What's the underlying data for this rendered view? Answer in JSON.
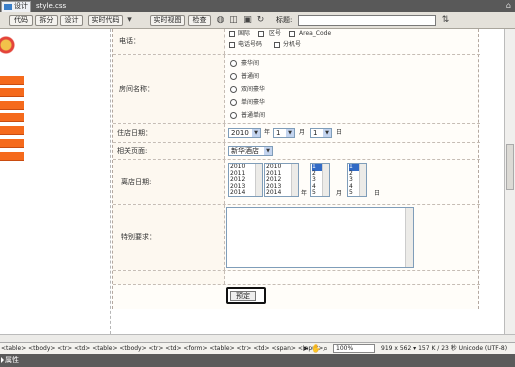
{
  "window": {
    "doc_tab": "设计",
    "file_name": "style.css",
    "right_glyph": "⌂"
  },
  "toolbar": {
    "code_label": "代码",
    "split_label": "拆分",
    "design_label": "设计",
    "live_code_label": "实时代码",
    "live_view_label": "实时视图",
    "inspect_label": "检查",
    "title_label": "标题:",
    "title_value": ""
  },
  "form": {
    "phone": {
      "label": "电话：",
      "line1": [
        "国际",
        "区号",
        "Area_Code"
      ],
      "line2": [
        "电话号码",
        "分机号"
      ]
    },
    "room": {
      "label": "房间名称：",
      "options": [
        "豪华间",
        "普通间",
        "双间豪华",
        "单间豪华",
        "普通单间"
      ]
    },
    "checkin": {
      "label": "住店日期：",
      "year": "2010",
      "year_unit": "年",
      "month": "1",
      "month_unit": "月",
      "day": "1",
      "day_unit": "日"
    },
    "related": {
      "label": "相关页面:",
      "value": "新华酒店"
    },
    "checkout": {
      "label": "离店日期:",
      "year_list_a": [
        "2010",
        "2011",
        "2012",
        "2013",
        "2014"
      ],
      "year_list_b": [
        "2010",
        "2011",
        "2012",
        "2013",
        "2014"
      ],
      "year_unit": "年",
      "month_list": [
        "1",
        "2",
        "3",
        "4",
        "5"
      ],
      "month_unit": "月",
      "day_list": [
        "1",
        "2",
        "3",
        "4",
        "5"
      ],
      "day_unit": "日"
    },
    "special": {
      "label": "特别要求："
    },
    "submit_label": "预定"
  },
  "status": {
    "tag_path": "<table> <tbody> <tr> <td> <table> <tbody> <tr> <td> <form> <table> <tr> <td> <span> <input>",
    "zoom": "100%",
    "info": "919 x 562 ▾ 157 K / 23 秒 Unicode (UTF-8)"
  },
  "properties_panel": {
    "label": "属性"
  },
  "colors": {
    "accent_orange": "#f56a1c",
    "selection_blue": "#316ac5"
  }
}
